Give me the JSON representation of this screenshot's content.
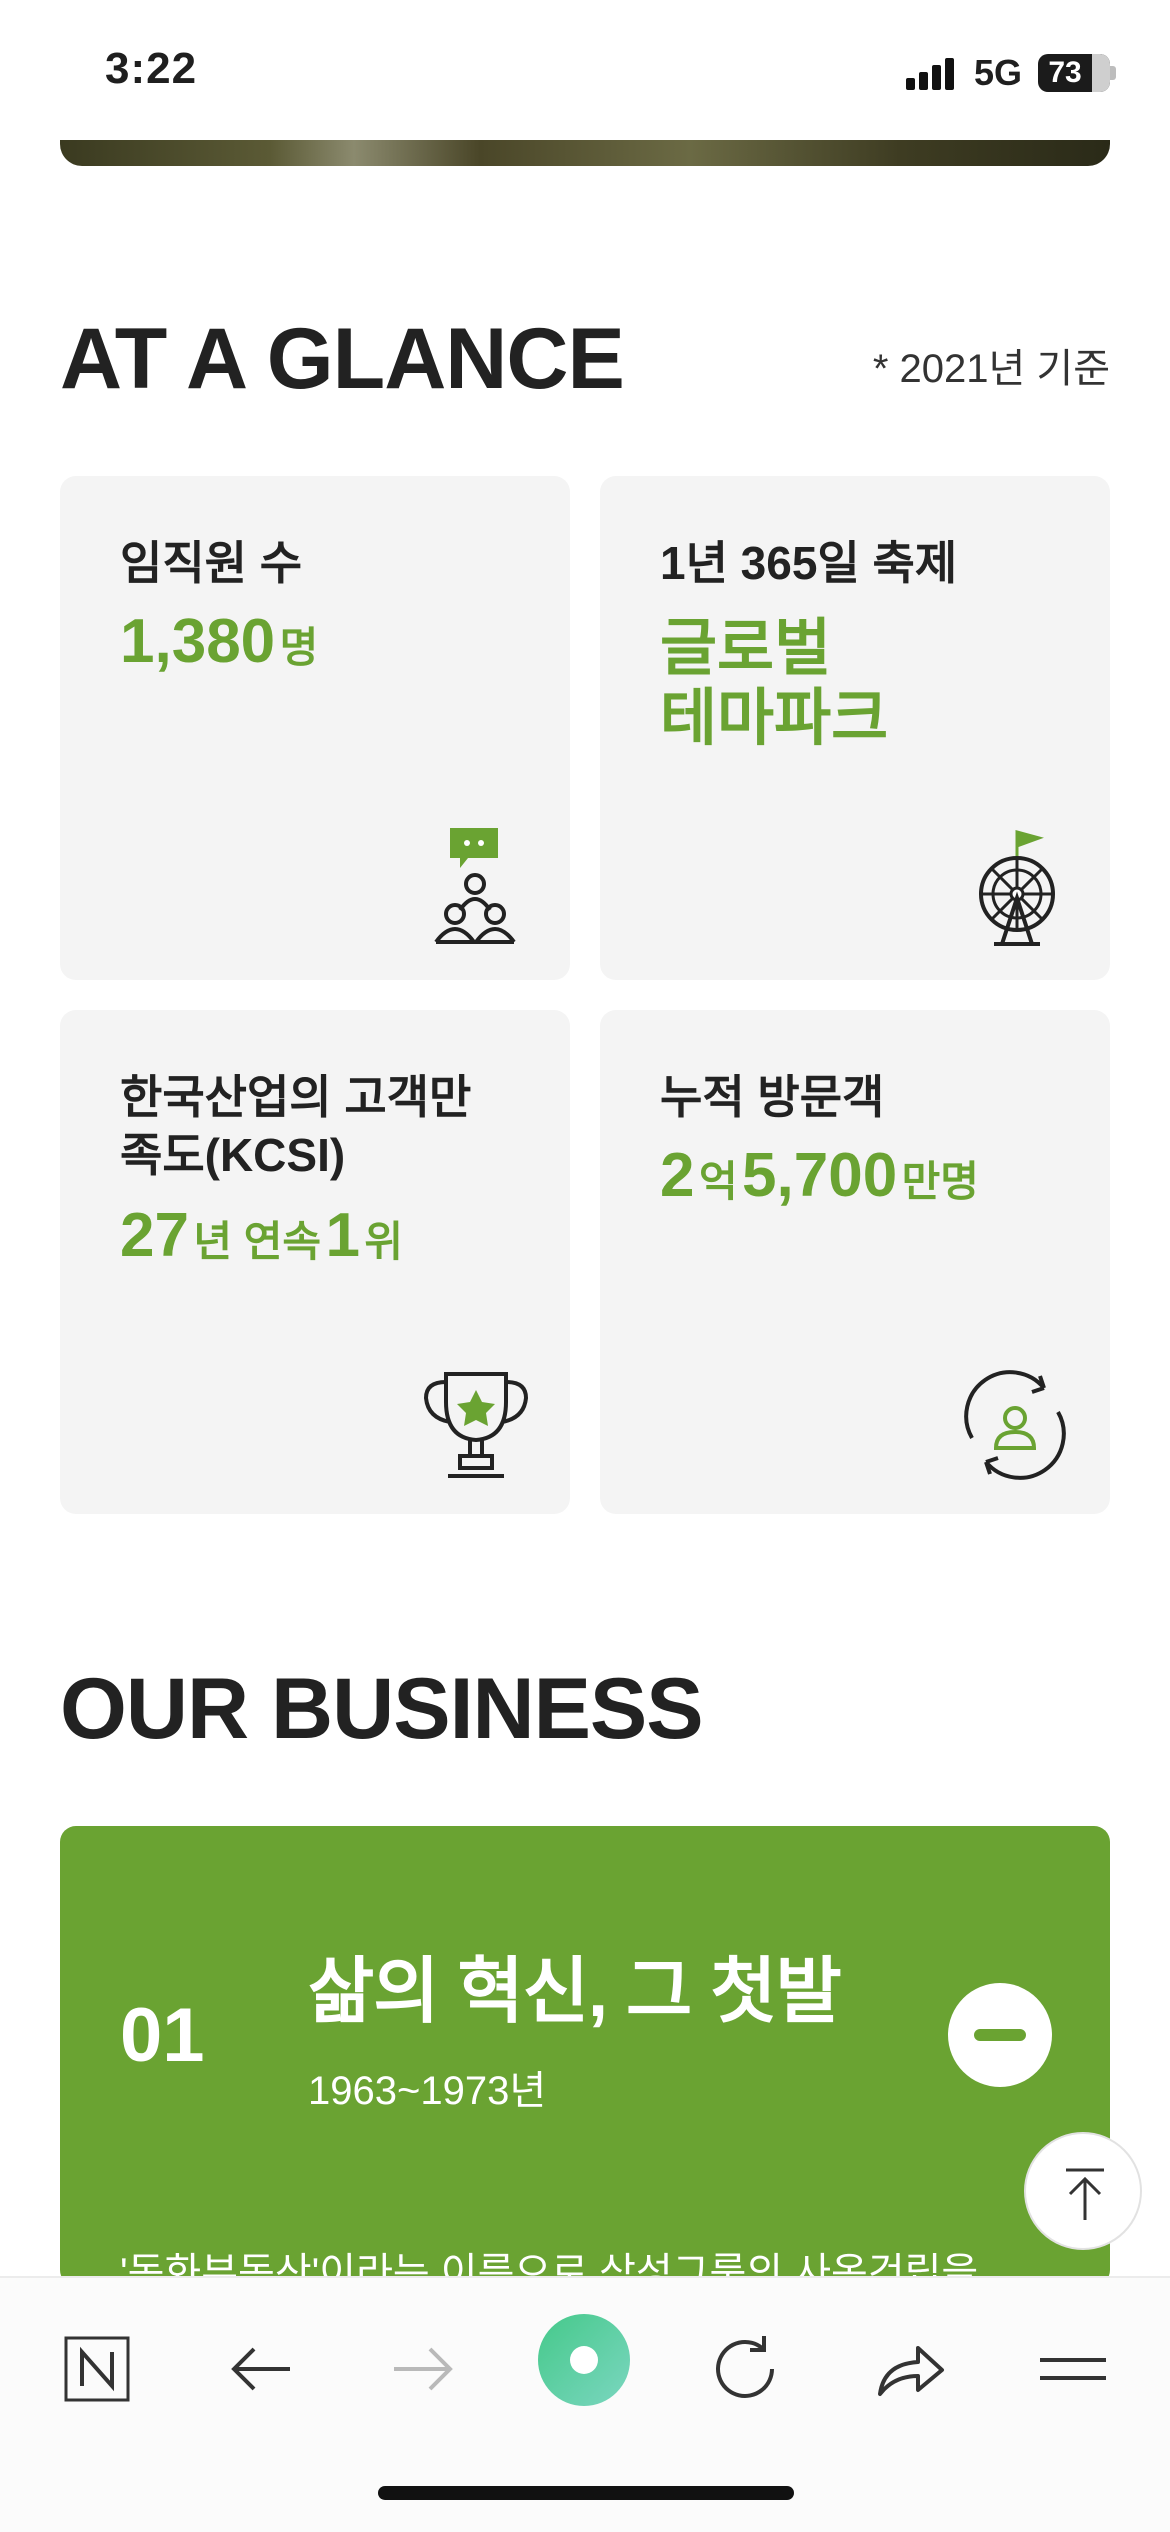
{
  "status_bar": {
    "time": "3:22",
    "network": "5G",
    "battery": "73"
  },
  "glance": {
    "title": "AT A GLANCE",
    "basis": "* 2021년 기준",
    "cards": [
      {
        "label": "임직원 수",
        "value_num": "1,380",
        "value_unit": "명",
        "icon": "people-chat-icon"
      },
      {
        "label": "1년 365일 축제",
        "value_line1": "글로벌",
        "value_line2": "테마파크",
        "icon": "ferris-wheel-icon"
      },
      {
        "label_line1": "한국산업의 고객만",
        "label_line2": "족도(KCSI)",
        "value_num1": "27",
        "value_unit1": "년 연속",
        "value_num2": "1",
        "value_unit2": "위",
        "icon": "trophy-icon"
      },
      {
        "label": "누적 방문객",
        "value_num1": "2",
        "value_unit1": "억",
        "value_num2": "5,700",
        "value_unit2": "만명",
        "icon": "visitor-cycle-icon"
      }
    ]
  },
  "business": {
    "title": "OUR BUSINESS",
    "item": {
      "number": "01",
      "title": "삶의 혁신, 그 첫발",
      "years": "1963~1973년",
      "description": "'동화부동산'이라는 이름으로 삼성그룹의 사옥건립을"
    }
  },
  "bottom_bar": {
    "items": [
      "naver-home-icon",
      "back-arrow-icon",
      "forward-arrow-icon",
      "assistant-orb-icon",
      "reload-icon",
      "share-icon",
      "menu-icon"
    ]
  },
  "colors": {
    "accent": "#6aa332",
    "card_bg": "#f4f4f4"
  }
}
